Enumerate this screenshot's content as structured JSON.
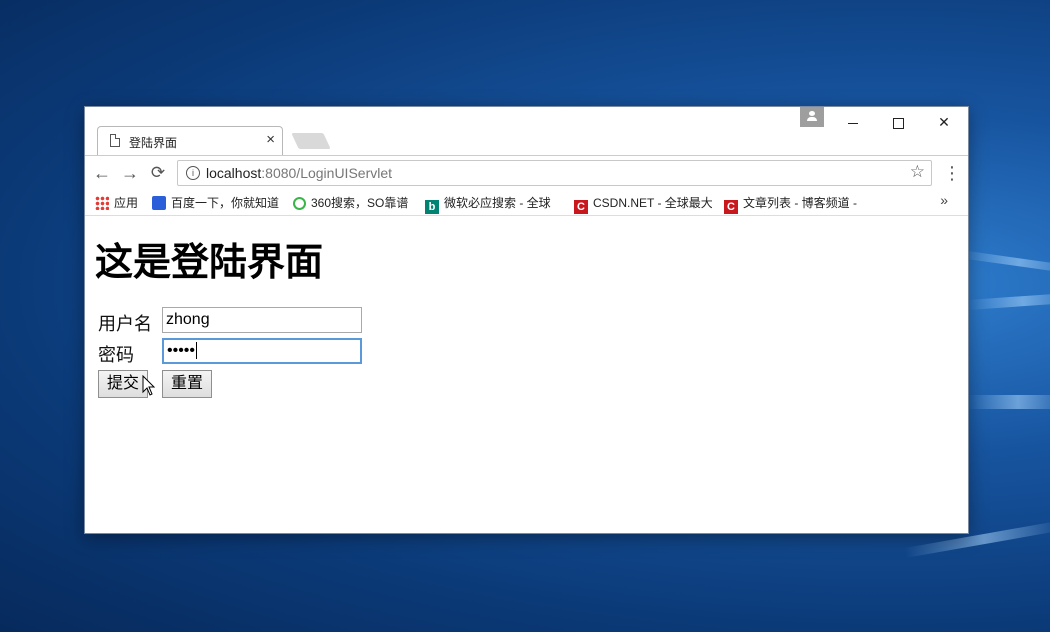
{
  "browser": {
    "tab_title": "登陆界面",
    "tab_close": "×",
    "url_host": "localhost",
    "url_rest": ":8080/LoginUIServlet",
    "star": "☆",
    "back": "←",
    "forward": "→",
    "reload": "⟳",
    "menu": "⋮",
    "window_minimize": "—",
    "window_maximize": "☐",
    "window_close": "✕",
    "bookmarks_more": "»",
    "bookmarks": [
      {
        "label": "应用",
        "icon": "apps-grid-icon"
      },
      {
        "label": "百度一下，你就知道",
        "icon": "baidu-paw-icon"
      },
      {
        "label": "360搜索，SO靠谱",
        "icon": "so360-icon"
      },
      {
        "label": "微软必应搜索 - 全球",
        "icon": "bing-icon"
      },
      {
        "label": "CSDN.NET - 全球最大",
        "icon": "csdn-icon"
      },
      {
        "label": "文章列表 - 博客频道 -",
        "icon": "csdn-icon"
      }
    ]
  },
  "page": {
    "heading": "这是登陆界面",
    "username_label": "用户名",
    "username_value": "zhong",
    "password_label": "密码",
    "password_value": "•••••",
    "submit_label": "提交",
    "reset_label": "重置"
  }
}
